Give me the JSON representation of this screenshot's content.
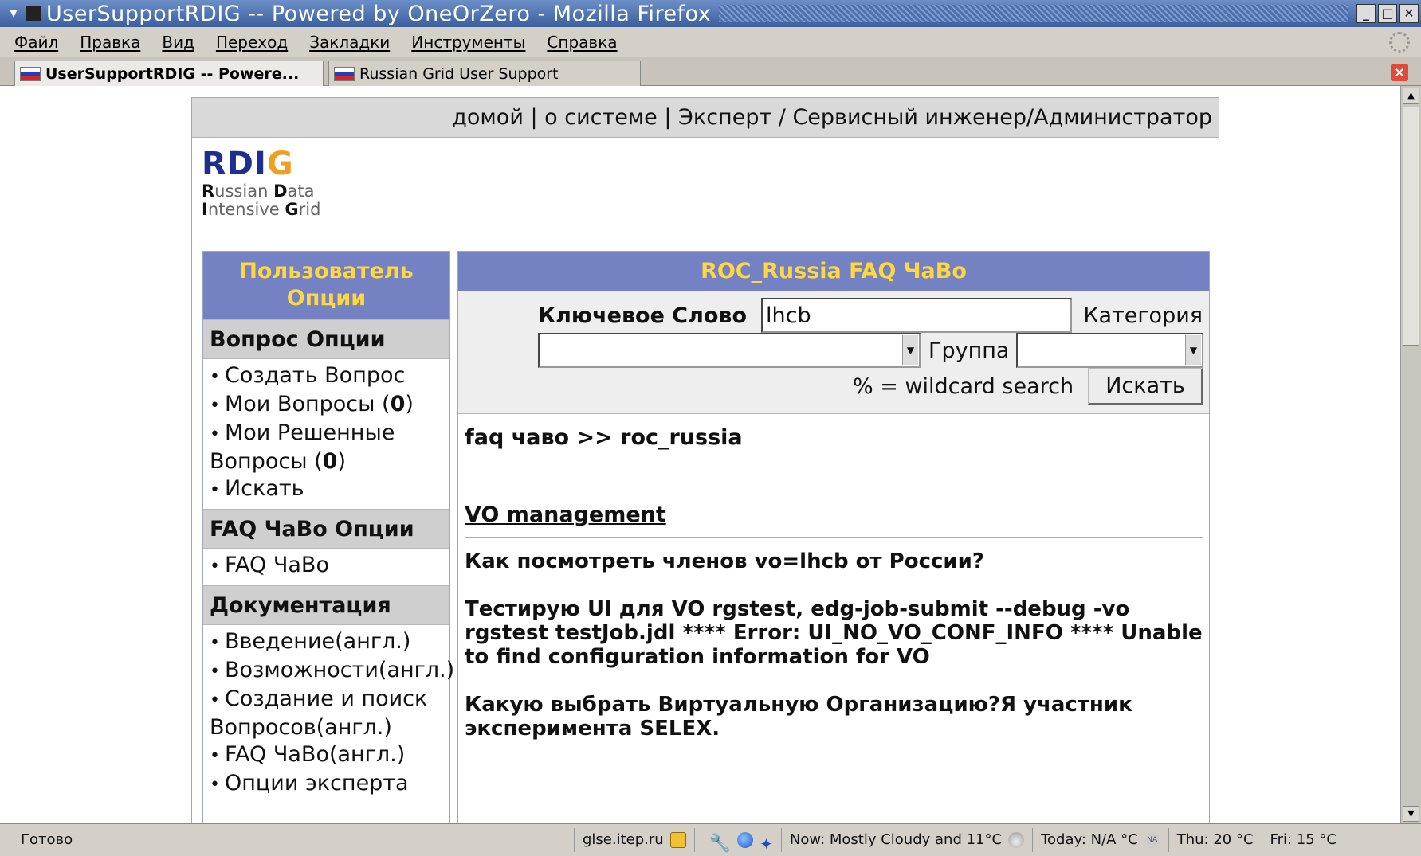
{
  "window": {
    "title": "UserSupportRDIG -- Powered by OneOrZero - Mozilla Firefox",
    "menu_glyph": "▾"
  },
  "menubar": {
    "items": [
      "Файл",
      "Правка",
      "Вид",
      "Переход",
      "Закладки",
      "Инструменты",
      "Справка"
    ]
  },
  "tabs": [
    {
      "label": "UserSupportRDIG -- Powere...",
      "active": true
    },
    {
      "label": "Russian Grid User Support",
      "active": false
    }
  ],
  "page": {
    "topnav": "домой | о системе | Эксперт / Сервисный инженер/Администратор",
    "logo": {
      "mark_1": "RDI",
      "mark_2": "G",
      "line1_b1": "R",
      "line1_t1": "ussian ",
      "line1_b2": "D",
      "line1_t2": "ata",
      "line2_b1": "I",
      "line2_t1": "ntensive ",
      "line2_b2": "G",
      "line2_t2": "rid"
    },
    "sidebar": {
      "header": "Пользователь Опции",
      "sections": [
        {
          "title": "Вопрос Опции",
          "items": [
            "Создать Вопрос",
            "Мои Вопросы",
            "Мои Решенные Вопросы",
            "Искать"
          ],
          "count_my": "0",
          "count_solved": "0"
        },
        {
          "title": "FAQ ЧаВо Опции",
          "items": [
            "FAQ ЧаВо"
          ]
        },
        {
          "title": "Документация",
          "items": [
            "Введение(англ.)",
            "Возможности(англ.)",
            "Создание и поиск Вопросов(англ.)",
            "FAQ ЧаВо(англ.)",
            "Опции эксперта"
          ]
        }
      ]
    },
    "main": {
      "header": "ROC_Russia FAQ ЧаВо",
      "search": {
        "keyword_label": "Ключевое Слово",
        "keyword_value": "lhcb",
        "category_label": "Категория",
        "category_value": "",
        "group_label": "Группа",
        "group_value": "",
        "wildcard_hint": "% = wildcard search",
        "search_button": "Искать"
      },
      "breadcrumb": "faq чаво >> roc_russia",
      "section_title": "VO management",
      "questions": [
        "Как посмотреть членов vo=lhcb от России?",
        "Тестирую UI для VO rgstest, edg-job-submit --debug -vo rgstest testJob.jdl **** Error: UI_NO_VO_CONF_INFO **** Unable to find configuration information for VO",
        "Какую выбрать Виртуальную Организацию?Я участник эксперимента SELEX."
      ]
    }
  },
  "statusbar": {
    "status": "Готово",
    "host": "glse.itep.ru",
    "weather_now": "Now: Mostly Cloudy and 11°C",
    "weather_today": "Today: N/A °C",
    "na_badge": "NA",
    "weather_thu": "Thu: 20 °C",
    "weather_fri": "Fri: 15 °C"
  }
}
